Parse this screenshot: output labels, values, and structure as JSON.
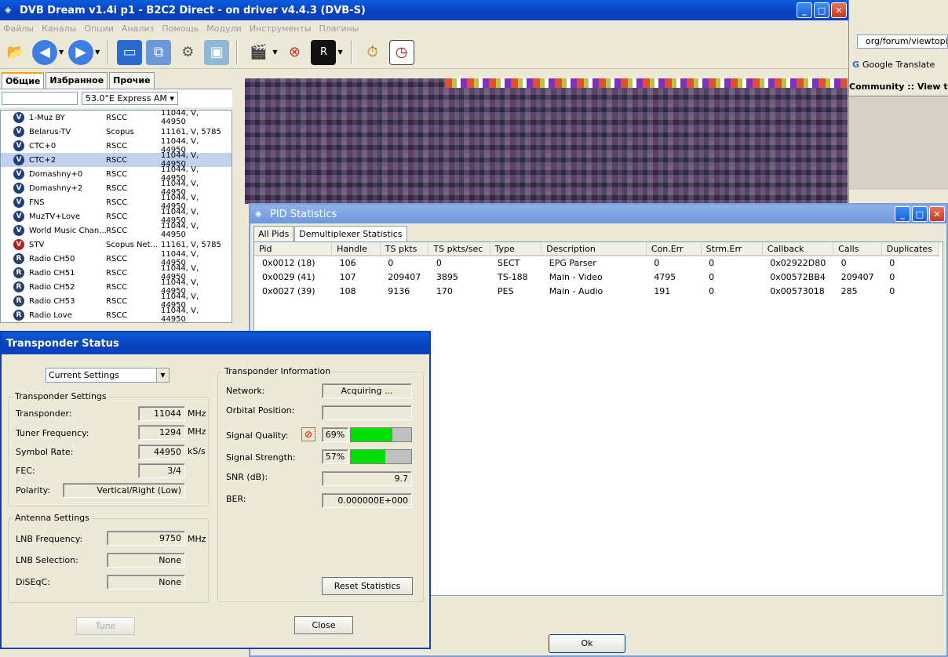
{
  "main_window": {
    "title": "DVB Dream v1.4i p1 - B2C2 Direct - on driver v4.4.3 (DVB-S)",
    "menu": [
      "Файлы",
      "Каналы",
      "Опции",
      "Анализ",
      "Помощь",
      "Модули",
      "Инструменты",
      "Плагины"
    ]
  },
  "left_panel": {
    "tabs": [
      "Общие",
      "Избранное",
      "Прочие"
    ],
    "satellite": "53.0°E Express AM",
    "channels": [
      {
        "icon": "V",
        "name": "1-Muz BY",
        "provider": "RSCC",
        "freq": "11044, V, 44950"
      },
      {
        "icon": "V",
        "name": "Belarus-TV",
        "provider": "Scopus",
        "freq": "11161, V, 5785"
      },
      {
        "icon": "V",
        "name": "CTC+0",
        "provider": "RSCC",
        "freq": "11044, V, 44950"
      },
      {
        "icon": "V",
        "name": "CTC+2",
        "provider": "RSCC",
        "freq": "11044, V, 44950"
      },
      {
        "icon": "V",
        "name": "Domashny+0",
        "provider": "RSCC",
        "freq": "11044, V, 44950"
      },
      {
        "icon": "V",
        "name": "Domashny+2",
        "provider": "RSCC",
        "freq": "11044, V, 44950"
      },
      {
        "icon": "V",
        "name": "FNS",
        "provider": "RSCC",
        "freq": "11044, V, 44950"
      },
      {
        "icon": "V",
        "name": "MuzTV+Love",
        "provider": "RSCC",
        "freq": "11044, V, 44950"
      },
      {
        "icon": "V",
        "name": "World Music Chan...",
        "provider": "RSCC",
        "freq": "11044, V, 44950"
      },
      {
        "icon": "V",
        "name": "STV",
        "provider": "Scopus Net...",
        "freq": "11161, V, 5785"
      },
      {
        "icon": "R",
        "name": "Radio CH50",
        "provider": "RSCC",
        "freq": "11044, V, 44950"
      },
      {
        "icon": "R",
        "name": "Radio CH51",
        "provider": "RSCC",
        "freq": "11044, V, 44950"
      },
      {
        "icon": "R",
        "name": "Radio CH52",
        "provider": "RSCC",
        "freq": "11044, V, 44950"
      },
      {
        "icon": "R",
        "name": "Radio CH53",
        "provider": "RSCC",
        "freq": "11044, V, 44950"
      },
      {
        "icon": "R",
        "name": "Radio Love",
        "provider": "RSCC",
        "freq": "11044, V, 44950"
      }
    ]
  },
  "browser": {
    "address": "org/forum/viewtopic.p",
    "translate": "Google Translate",
    "page_title": "Community :: View to..."
  },
  "pid_window": {
    "title": "PID Statistics",
    "tabs": [
      "All Pids",
      "Demultiplexer Statistics"
    ],
    "columns": [
      "Pid",
      "Handle",
      "TS pkts",
      "TS pkts/sec",
      "Type",
      "Description",
      "Con.Err",
      "Strm.Err",
      "Callback",
      "Calls",
      "Duplicates"
    ],
    "rows": [
      [
        "0x0012 (18)",
        "106",
        "0",
        "0",
        "SECT",
        "EPG Parser",
        "0",
        "0",
        "0x02922D80",
        "0",
        "0"
      ],
      [
        "0x0029 (41)",
        "107",
        "209407",
        "3895",
        "TS-188",
        "Main - Video",
        "4795",
        "0",
        "0x00572BB4",
        "209407",
        "0"
      ],
      [
        "0x0027 (39)",
        "108",
        "9136",
        "170",
        "PES",
        "Main - Audio",
        "191",
        "0",
        "0x00573018",
        "285",
        "0"
      ]
    ],
    "ok_label": "Ok"
  },
  "transponder": {
    "title": "Transponder Status",
    "settings_select": "Current Settings",
    "settings_group": "Transponder Settings",
    "transponder_label": "Transponder:",
    "transponder_value": "11044",
    "transponder_unit": "MHz",
    "tuner_label": "Tuner Frequency:",
    "tuner_value": "1294",
    "tuner_unit": "MHz",
    "symbol_label": "Symbol Rate:",
    "symbol_value": "44950",
    "symbol_unit": "kS/s",
    "fec_label": "FEC:",
    "fec_value": "3/4",
    "polarity_label": "Polarity:",
    "polarity_value": "Vertical/Right (Low)",
    "antenna_group": "Antenna Settings",
    "lnb_freq_label": "LNB Frequency:",
    "lnb_freq_value": "9750",
    "lnb_freq_unit": "MHz",
    "lnb_sel_label": "LNB Selection:",
    "lnb_sel_value": "None",
    "diseqc_label": "DiSEqC:",
    "diseqc_value": "None",
    "info_group": "Transponder Information",
    "network_label": "Network:",
    "network_value": "Acquiring ...",
    "orbital_label": "Orbital Position:",
    "orbital_value": "",
    "quality_label": "Signal Quality:",
    "quality_value": "69%",
    "quality_level": 0.69,
    "strength_label": "Signal Strength:",
    "strength_value": "57%",
    "strength_level": 0.57,
    "snr_label": "SNR (dB):",
    "snr_value": "9.7",
    "ber_label": "BER:",
    "ber_value": "0.000000E+000",
    "reset_label": "Reset Statistics",
    "tune_label": "Tune",
    "close_label": "Close"
  }
}
